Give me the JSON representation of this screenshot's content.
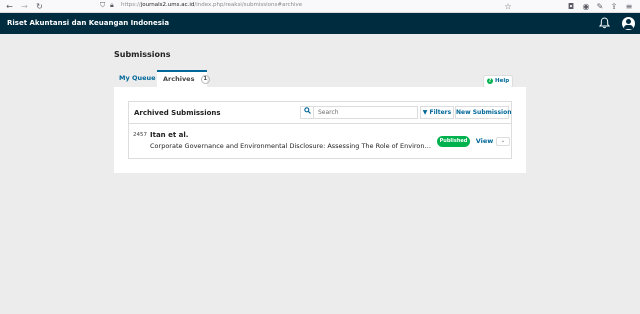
{
  "browser": {
    "url_prefix": "https://",
    "url_host": "journals2.ums.ac.id",
    "url_path": "/index.php/reaksi/submissions#archive"
  },
  "header": {
    "site_title": "Riset Akuntansi dan Keuangan Indonesia",
    "bell_icon": "bell-icon",
    "user_icon": "user-icon"
  },
  "page": {
    "title": "Submissions"
  },
  "tabs": [
    {
      "label": "My Queue"
    },
    {
      "label": "Archives",
      "count": "1"
    }
  ],
  "help": {
    "label": "Help"
  },
  "list": {
    "title": "Archived Submissions",
    "search_placeholder": "Search",
    "filters_label": "Filters",
    "new_submission_label": "New Submission"
  },
  "submissions": [
    {
      "id": "2457",
      "author": "Itan et al.",
      "title": "Corporate Governance and Environmental Disclosure: Assessing The Role of Environmental Performance",
      "status": "Published",
      "view_label": "View"
    }
  ],
  "colors": {
    "header_bg": "#002c40",
    "accent": "#006798",
    "status_published": "#00b24e"
  }
}
